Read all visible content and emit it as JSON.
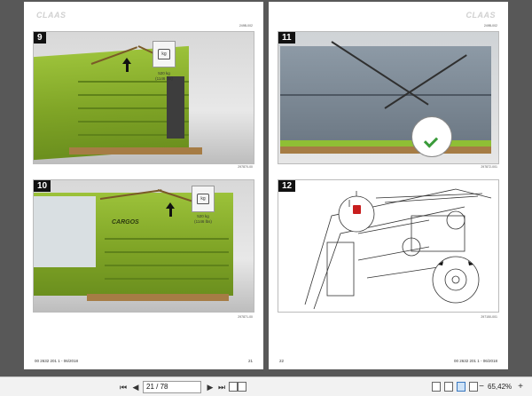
{
  "left_page": {
    "logo": "CLAAS",
    "figure_top": {
      "number": "9",
      "code_top": "249B-002",
      "weight": "520 kg",
      "weight_alt": "(1146 lbs)",
      "icon_text": "kg",
      "code_under": "297870-00"
    },
    "figure_bottom": {
      "number": "10",
      "weight": "520 kg",
      "weight_alt": "(1146 lbs)",
      "icon_text": "kg",
      "brand_text": "CARGOS",
      "code_under": "297871-00"
    },
    "footer_doc": "00 2632 201 1 - 06/2018",
    "page_number": "21"
  },
  "right_page": {
    "logo": "CLAAS",
    "figure_top": {
      "number": "11",
      "code_top": "249B-002",
      "code_under": "297872-001"
    },
    "figure_bottom": {
      "number": "12",
      "code_under": "297150-001"
    },
    "footer_doc": "00 2632 201 1 - 06/2018",
    "page_number": "22"
  },
  "toolbar": {
    "first_icon": "skip-first-icon",
    "prev_icon": "prev-page-icon",
    "page_value": "21 / 78",
    "next_icon": "next-page-icon",
    "last_icon": "skip-last-icon",
    "zoom": "65,42%",
    "zoom_out_icon": "zoom-out-icon",
    "zoom_in_icon": "zoom-in-icon"
  }
}
